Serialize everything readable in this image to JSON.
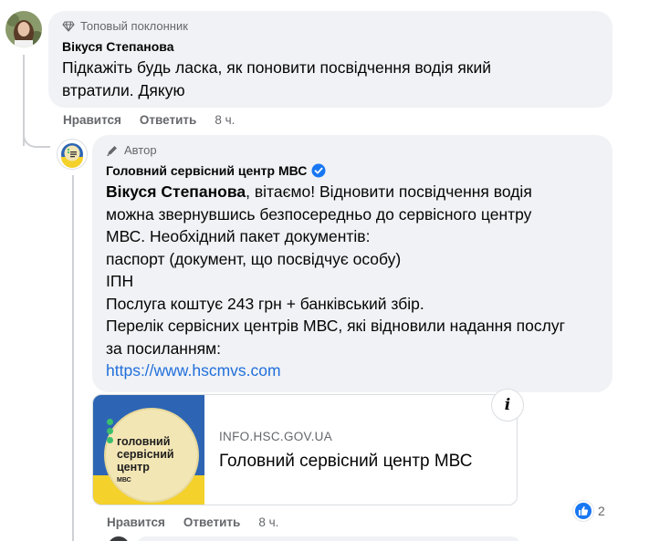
{
  "comment1": {
    "badge": "Топовый поклонник",
    "author": "Вікуся Степанова",
    "text_line1": "Підкажіть будь ласка, як поновити посвідчення водія який",
    "text_line2": "втратили. Дякую",
    "actions": {
      "like": "Нравится",
      "reply": "Ответить",
      "time": "8 ч."
    }
  },
  "reply": {
    "badge": "Автор",
    "author": "Головний сервісний центр МВС",
    "mention": "Вікуся Степанова",
    "lines": [
      ", вітаємо! Відновити посвідчення водія",
      "можна звернувшись безпосередньо до сервісного центру",
      "МВС. Необхідний пакет документів:",
      "паспорт (документ, що посвідчує особу)",
      "ІПН",
      "Послуга коштує 243 грн + банківський збір.",
      "Перелік сервісних центрів МВС, які відновили надання послуг",
      "за посиланням:"
    ],
    "link": "https://www.hscmvs.com",
    "preview": {
      "domain": "INFO.HSC.GOV.UA",
      "title": "Головний сервісний центр МВС",
      "thumb_line1": "головний",
      "thumb_line2": "сервісний",
      "thumb_line3": "центр",
      "thumb_sub": "МВС",
      "info_label": "i"
    },
    "actions": {
      "like": "Нравится",
      "reply": "Ответить",
      "time": "8 ч."
    },
    "reaction_count": "2"
  },
  "colors": {
    "link": "#216fdb",
    "bubble": "#f0f2f5",
    "secondary": "#65676b",
    "verified": "#1877f2"
  }
}
